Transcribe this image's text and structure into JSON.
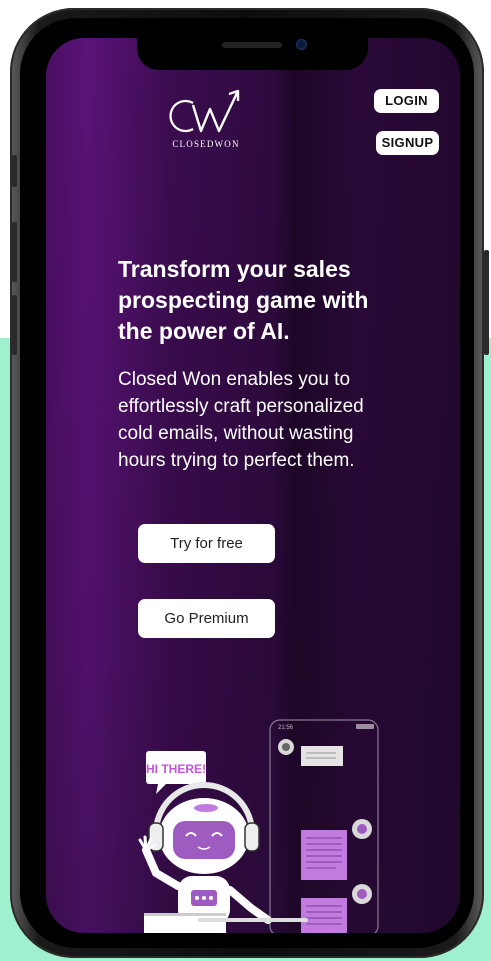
{
  "brand": {
    "logo_text": "CLOSEDWON"
  },
  "header": {
    "login_label": "LOGIN",
    "signup_label": "SIGNUP"
  },
  "hero": {
    "headline": "Transform your sales prospecting game with the power of AI.",
    "subtext": "Closed Won enables you to effortlessly craft personalized cold emails, without wasting hours trying to perfect them."
  },
  "actions": {
    "try_label": "Try for free",
    "premium_label": "Go Premium"
  },
  "illustration": {
    "bubble_text": "HI THERE!",
    "time": "21:56"
  },
  "colors": {
    "background_mint": "#9ff0cf",
    "screen_purple": "#3c0c50",
    "accent_lilac": "#c17be0"
  }
}
